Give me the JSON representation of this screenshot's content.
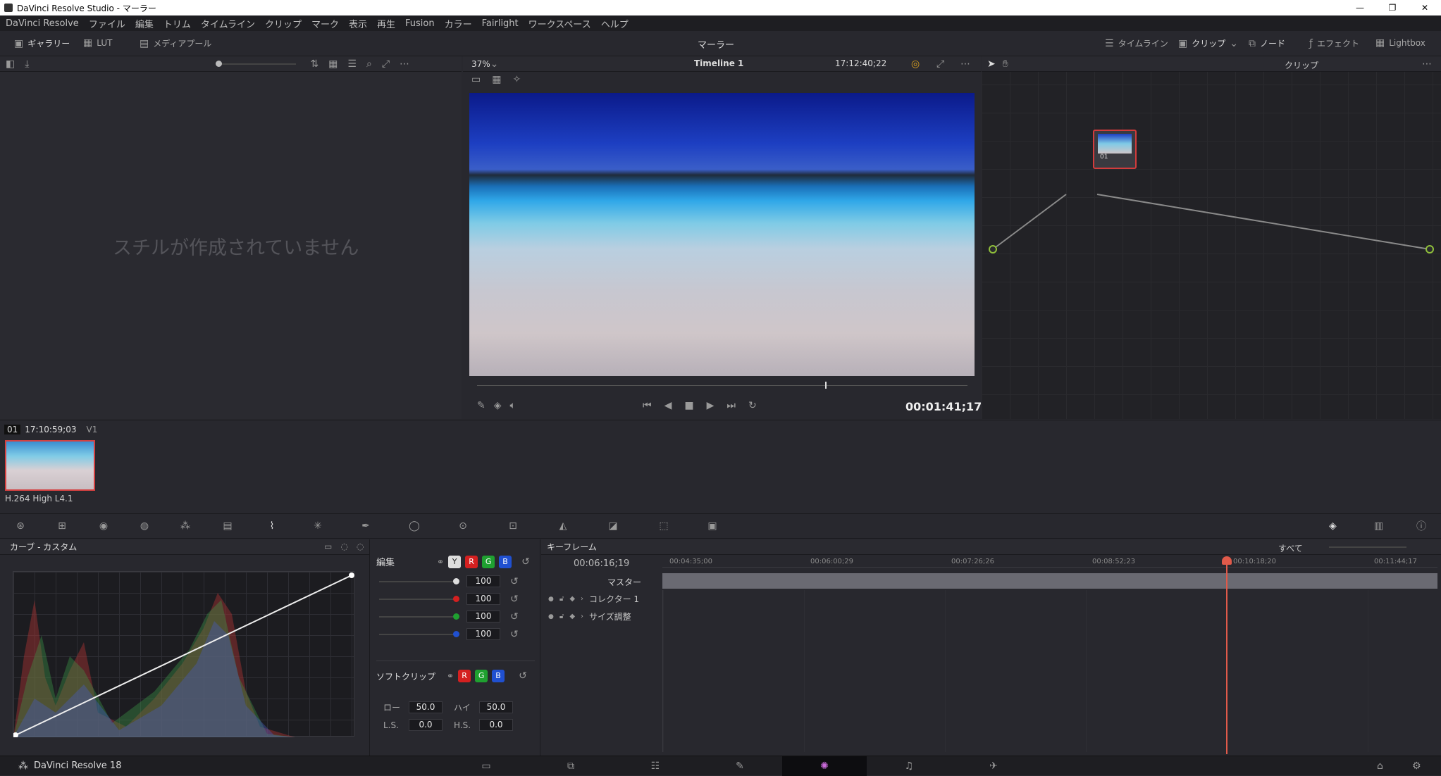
{
  "window": {
    "title": "DaVinci Resolve Studio - マーラー",
    "controls": [
      "—",
      "❐",
      "✕"
    ]
  },
  "menu": [
    "DaVinci Resolve",
    "ファイル",
    "編集",
    "トリム",
    "タイムライン",
    "クリップ",
    "マーク",
    "表示",
    "再生",
    "Fusion",
    "カラー",
    "Fairlight",
    "ワークスペース",
    "ヘルプ"
  ],
  "toolbar": {
    "gallery": "ギャラリー",
    "lut": "LUT",
    "mediapool": "メディアプール",
    "project_title": "マーラー",
    "timeline": "タイムライン",
    "clip": "クリップ",
    "node": "ノード",
    "effects": "エフェクト",
    "lightbox": "Lightbox"
  },
  "gallery": {
    "empty_text": "スチルが作成されていません"
  },
  "viewer": {
    "zoom": "37%",
    "timeline_name": "Timeline 1",
    "timecode_top": "17:12:40;22",
    "timecode": "00:01:41;17",
    "playhead_fraction": 0.71
  },
  "nodes": {
    "node_label": "01",
    "mode": "クリップ"
  },
  "clip": {
    "number": "01",
    "timecode": "17:10:59;03",
    "track": "V1",
    "codec": "H.264 High L4.1"
  },
  "curves": {
    "title": "カーブ - カスタム"
  },
  "edit": {
    "title": "編集",
    "values": [
      "100",
      "100",
      "100",
      "100"
    ],
    "softclip_title": "ソフトクリップ",
    "lo_label": "ロー",
    "hi_label": "ハイ",
    "lo": "50.0",
    "hi": "50.0",
    "ls_label": "L.S.",
    "hs_label": "H.S.",
    "ls": "0.0",
    "hs": "0.0",
    "y": "Y",
    "r": "R",
    "g": "G",
    "b": "B"
  },
  "keyframes": {
    "title": "キーフレーム",
    "filter": "すべて",
    "timecode": "00:06:16;19",
    "ruler": [
      "00:04:35;00",
      "00:06:00;29",
      "00:07:26;26",
      "00:08:52;23",
      "00:10:18;20",
      "00:11:44;17"
    ],
    "master": "マスター",
    "rows": [
      "コレクター 1",
      "サイズ調整"
    ]
  },
  "app": {
    "name": "DaVinci Resolve 18"
  },
  "colors": {
    "accent_red": "#e05a4a",
    "node_border": "#d23c3c",
    "clip_border": "#d44040"
  }
}
